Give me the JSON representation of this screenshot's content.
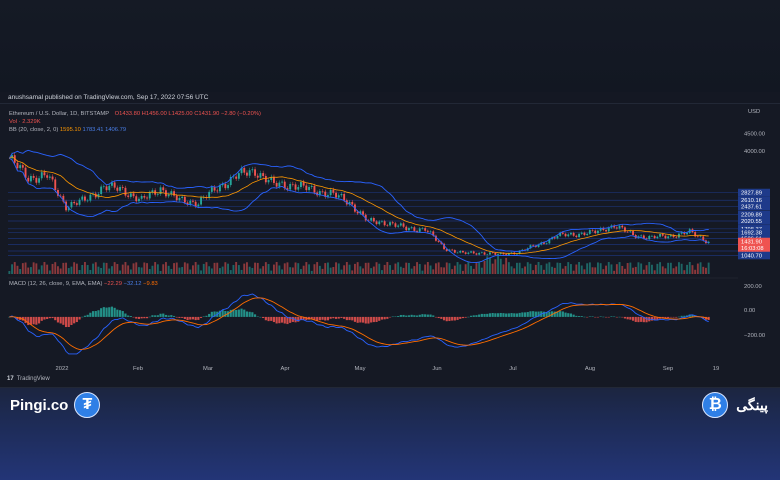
{
  "header": {
    "publisher": "anushsamal published on TradingView.com, Sep 17, 2022 07:56 UTC"
  },
  "legend": {
    "symbol": "Ethereum / U.S. Dollar, 1D, BITSTAMP",
    "ohlc": "O1433.80 H1456.00 L1425.00 C1431.90 −2.80 (−0.20%)",
    "vol": "Vol · 2.329K",
    "bb_label": "BB (20, close, 2, 0)",
    "bb_basis": "1595.10",
    "bb_upper": "1783.41",
    "bb_lower": "1406.79",
    "macd_label": "MACD (12, 26, close, 9, EMA, EMA)",
    "macd_hist": "−22.29",
    "macd_line": "−32.12",
    "macd_signal": "−9.83"
  },
  "price_axis": {
    "currency": "USD",
    "ticks": [
      "4500.00",
      "4000.00"
    ],
    "levels": [
      "2827.89",
      "2610.16",
      "2437.61",
      "2209.89",
      "2020.55",
      "1798.37",
      "1692.38",
      "1526.61",
      "1350.84",
      "1169.35",
      "1040.70"
    ],
    "last_price": "1431.90",
    "countdown": "16:03:08"
  },
  "macd_axis": {
    "ticks": [
      "200.00",
      "0.00",
      "−200.00"
    ]
  },
  "time_axis": {
    "labels": [
      "2022",
      "Feb",
      "Mar",
      "Apr",
      "May",
      "Jun",
      "Jul",
      "Aug",
      "Sep",
      "19"
    ]
  },
  "footer": {
    "tradingview": "TradingView"
  },
  "branding": {
    "left": "Pingi.co",
    "right": "پینگی",
    "tether_icon": "₮",
    "bitcoin_icon": "₿"
  },
  "colors": {
    "up": "#26a69a",
    "down": "#ef5350",
    "bb": "#2962ff",
    "basis": "#ff9800",
    "macd": "#2962ff",
    "signal": "#ff6d00",
    "level_bg": "#1e3a8a"
  },
  "chart_data": {
    "type": "candlestick",
    "symbol": "ETH/USD",
    "timeframe": "1D",
    "x": [
      "2022-01-01",
      "2022-01-08",
      "2022-01-15",
      "2022-01-22",
      "2022-01-29",
      "2022-02-05",
      "2022-02-12",
      "2022-02-19",
      "2022-02-26",
      "2022-03-05",
      "2022-03-12",
      "2022-03-19",
      "2022-03-26",
      "2022-04-02",
      "2022-04-09",
      "2022-04-16",
      "2022-04-23",
      "2022-04-30",
      "2022-05-07",
      "2022-05-14",
      "2022-05-21",
      "2022-05-28",
      "2022-06-04",
      "2022-06-11",
      "2022-06-18",
      "2022-06-25",
      "2022-07-02",
      "2022-07-09",
      "2022-07-16",
      "2022-07-23",
      "2022-07-30",
      "2022-08-06",
      "2022-08-13",
      "2022-08-20",
      "2022-08-27",
      "2022-09-03",
      "2022-09-10",
      "2022-09-17"
    ],
    "close": [
      3800,
      3250,
      3300,
      2450,
      2600,
      3000,
      2900,
      2600,
      2950,
      2600,
      2550,
      2950,
      3300,
      3450,
      3050,
      3050,
      2900,
      2800,
      2550,
      2000,
      1980,
      1800,
      1800,
      1250,
      1100,
      1120,
      1060,
      1150,
      1350,
      1600,
      1650,
      1700,
      1900,
      1620,
      1550,
      1600,
      1700,
      1431.9
    ],
    "ylim": [
      800,
      5000
    ],
    "bollinger": {
      "period": 20,
      "stddev": 2
    },
    "macd": {
      "fast": 12,
      "slow": 26,
      "signal": 9,
      "ylim": [
        -300,
        250
      ]
    },
    "last": {
      "open": 1433.8,
      "high": 1456.0,
      "low": 1425.0,
      "close": 1431.9
    }
  }
}
